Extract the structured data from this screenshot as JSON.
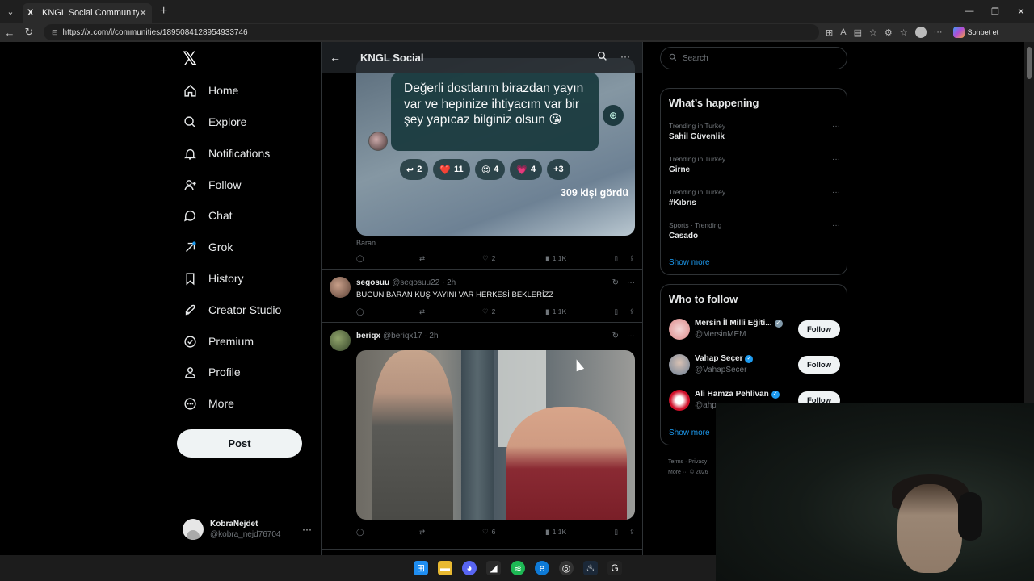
{
  "browser": {
    "tab_title": "KNGL Social Community / X",
    "url": "https://x.com/i/communities/1895084128954933746",
    "copilot_label": "Sohbet et"
  },
  "sidebar": {
    "items": [
      {
        "label": "Home",
        "icon": "home-icon"
      },
      {
        "label": "Explore",
        "icon": "search-icon"
      },
      {
        "label": "Notifications",
        "icon": "bell-icon"
      },
      {
        "label": "Follow",
        "icon": "person-add-icon"
      },
      {
        "label": "Chat",
        "icon": "chat-bubble-icon"
      },
      {
        "label": "Grok",
        "icon": "grok-icon"
      },
      {
        "label": "History",
        "icon": "bookmark-icon"
      },
      {
        "label": "Creator Studio",
        "icon": "rocket-icon"
      },
      {
        "label": "Premium",
        "icon": "verified-check-icon"
      },
      {
        "label": "Profile",
        "icon": "person-icon"
      },
      {
        "label": "More",
        "icon": "more-circle-icon"
      }
    ],
    "post_label": "Post",
    "account": {
      "name": "KobraNejdet",
      "handle": "@kobra_nejd76704"
    }
  },
  "header": {
    "title": "KNGL Social"
  },
  "story_post": {
    "bubble_text": "Değerli dostlarım birazdan yayın var ve hepinize ihtiyacım var bir şey yapıcaz bilginiz olsun 😘",
    "reactions": [
      {
        "icon": "reply-icon",
        "count": "2"
      },
      {
        "emoji": "❤️",
        "count": "11"
      },
      {
        "emoji": "😍",
        "count": "4"
      },
      {
        "emoji": "💗",
        "count": "4"
      },
      {
        "emoji": "",
        "count": "+3"
      }
    ],
    "seen_text": "309 kişi gördü",
    "caption": "Baran",
    "stats": {
      "likes": "2",
      "views": "1.1K"
    }
  },
  "tweets": [
    {
      "name": "segosuu",
      "handle": "@segosuu22 · 2h",
      "text": "BUGUN BARAN KUŞ YAYINI VAR HERKESİ BEKLERİZZ",
      "likes": "2",
      "views": "1.1K"
    },
    {
      "name": "beriqx",
      "handle": "@beriqx17 · 2h",
      "likes": "6",
      "views": "1.1K"
    }
  ],
  "right": {
    "search_placeholder": "Search",
    "whats_happening_title": "What’s happening",
    "trends": [
      {
        "context": "Trending in Turkey",
        "name": "Sahil Güvenlik"
      },
      {
        "context": "Trending in Turkey",
        "name": "Girne"
      },
      {
        "context": "Trending in Turkey",
        "name": "#Kıbrıs"
      },
      {
        "context": "Sports · Trending",
        "name": "Casado"
      }
    ],
    "show_more": "Show more",
    "who_to_follow_title": "Who to follow",
    "follow_suggestions": [
      {
        "name": "Mersin İl Millî Eğiti...",
        "handle": "@MersinMEM",
        "verified": "gray"
      },
      {
        "name": "Vahap Seçer",
        "handle": "@VahapSecer",
        "verified": "blue"
      },
      {
        "name": "Ali Hamza Pehlivan",
        "handle": "@ahp",
        "verified": "blue"
      }
    ],
    "follow_label": "Follow",
    "footer_line1": "Terms · Privacy",
    "footer_line2": "More ··· © 2026"
  },
  "colors": {
    "accent": "#1d9bf0",
    "background": "#000000",
    "border": "#2f3336",
    "muted": "#71767b"
  }
}
